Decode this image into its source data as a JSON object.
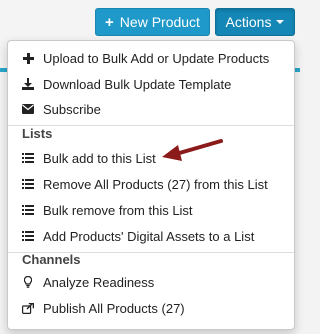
{
  "toolbar": {
    "new_product_label": "New Product",
    "new_product_icon": "plus-icon",
    "actions_label": "Actions",
    "actions_icon": "caret-down-icon"
  },
  "colors": {
    "primary_button": "#1e99c9",
    "active_button": "#1487b6",
    "annotation_arrow": "#8b1a1a"
  },
  "menu": {
    "top_items": [
      {
        "label": "Upload to Bulk Add or Update Products",
        "icon": "plus-icon"
      },
      {
        "label": "Download Bulk Update Template",
        "icon": "download-icon"
      },
      {
        "label": "Subscribe",
        "icon": "envelope-icon"
      }
    ],
    "lists_heading": "Lists",
    "lists_items": [
      {
        "label": "Bulk add to this List",
        "icon": "list-icon"
      },
      {
        "label": "Remove All Products (27) from this List",
        "icon": "list-icon"
      },
      {
        "label": "Bulk remove from this List",
        "icon": "list-icon"
      },
      {
        "label": "Add Products' Digital Assets to a List",
        "icon": "list-icon"
      }
    ],
    "channels_heading": "Channels",
    "channels_items": [
      {
        "label": "Analyze Readiness",
        "icon": "lightbulb-icon"
      },
      {
        "label": "Publish All Products (27)",
        "icon": "share-icon"
      }
    ]
  }
}
